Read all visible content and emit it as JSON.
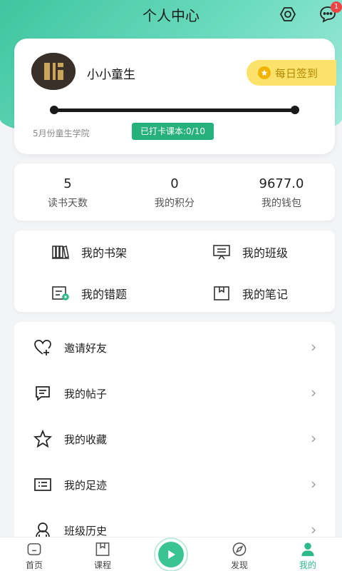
{
  "header": {
    "title": "个人中心",
    "notification_count": "1"
  },
  "profile": {
    "username": "小小童生",
    "checkin_label": "每日签到",
    "progress": 0.0,
    "school": "5月份童生学院",
    "punch_status": "已打卡课本:0/10"
  },
  "stats": [
    {
      "value": "5",
      "label": "读书天数"
    },
    {
      "value": "0",
      "label": "我的积分"
    },
    {
      "value": "9677.0",
      "label": "我的钱包"
    }
  ],
  "grid": {
    "bookshelf": "我的书架",
    "class": "我的班级",
    "mistakes": "我的错题",
    "notes": "我的笔记"
  },
  "menu": [
    {
      "label": "邀请好友",
      "icon": "heart-plus-icon"
    },
    {
      "label": "我的帖子",
      "icon": "chat-bubble-icon"
    },
    {
      "label": "我的收藏",
      "icon": "star-icon"
    },
    {
      "label": "我的足迹",
      "icon": "footprint-list-icon"
    },
    {
      "label": "班级历史",
      "icon": "class-history-icon"
    }
  ],
  "tabs": [
    {
      "label": "首页",
      "icon": "home-icon"
    },
    {
      "label": "课程",
      "icon": "course-icon"
    },
    {
      "label": "",
      "icon": "play-icon"
    },
    {
      "label": "发现",
      "icon": "discover-icon"
    },
    {
      "label": "我的",
      "icon": "profile-icon"
    }
  ],
  "colors": {
    "accent": "#2fb889",
    "checkin_bg": "#fbe26a",
    "badge": "#f04444"
  }
}
